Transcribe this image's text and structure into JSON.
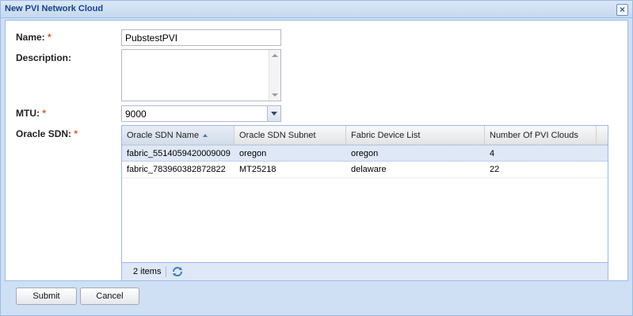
{
  "dialog": {
    "title": "New PVI Network Cloud",
    "close_icon": "close-icon"
  },
  "form": {
    "name_label": "Name:",
    "name_value": "PubstestPVI",
    "description_label": "Description:",
    "description_value": "",
    "mtu_label": "MTU:",
    "mtu_value": "9000",
    "sdn_label": "Oracle SDN:",
    "required_marker": "*"
  },
  "grid": {
    "columns": [
      {
        "label": "Oracle SDN Name",
        "sorted": "asc"
      },
      {
        "label": "Oracle SDN Subnet"
      },
      {
        "label": "Fabric Device List"
      },
      {
        "label": "Number Of PVI Clouds"
      }
    ],
    "rows": [
      {
        "name": "fabric_5514059420009009",
        "subnet": "oregon",
        "fabric": "oregon",
        "clouds": "4",
        "selected": true
      },
      {
        "name": "fabric_783960382872822",
        "subnet": "MT25218",
        "fabric": "delaware",
        "clouds": "22",
        "selected": false
      }
    ],
    "footer_count": "2 items",
    "refresh_icon": "refresh-icon"
  },
  "buttons": {
    "submit": "Submit",
    "cancel": "Cancel"
  },
  "colors": {
    "title_text": "#15428b",
    "required": "#e1551f",
    "selection": "#dfe8f6",
    "border_accent": "#99bbe8"
  }
}
